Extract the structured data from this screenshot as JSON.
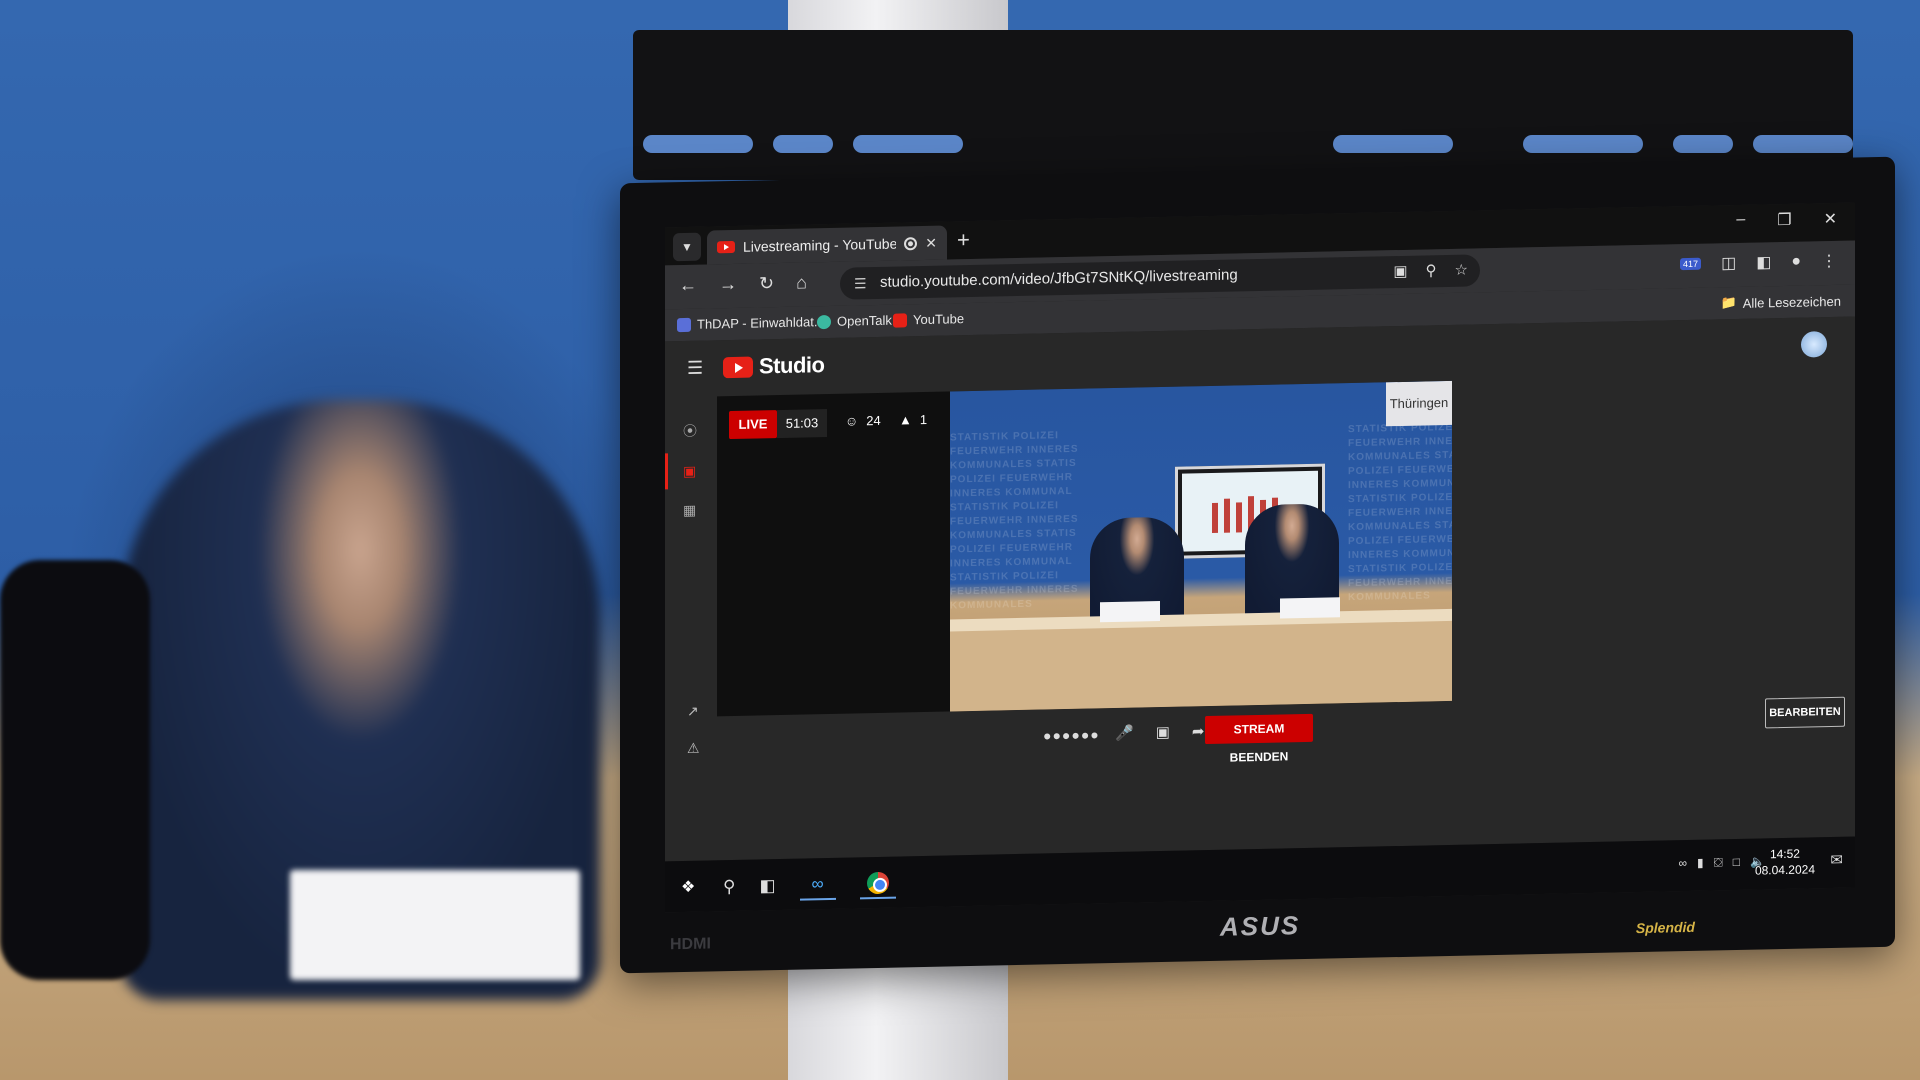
{
  "browser": {
    "tab_title": "Livestreaming - YouTube St",
    "url": "studio.youtube.com/video/JfbGt7SNtKQ/livestreaming",
    "extension_badge": "417",
    "bookmarks": [
      {
        "label": "ThDAP - Einwahldat...",
        "icon": "calendar-icon"
      },
      {
        "label": "OpenTalk",
        "icon": "opentalk-icon"
      },
      {
        "label": "YouTube",
        "icon": "youtube-icon"
      }
    ],
    "all_bookmarks": "Alle Lesezeichen"
  },
  "studio": {
    "logo_text": "Studio",
    "live_label": "LIVE",
    "elapsed": "51:03",
    "viewers": "24",
    "likes": "1",
    "video_logo_text": "Thüringen",
    "end_stream_label": "STREAM BEENDEN",
    "edit_label": "BEARBEITEN"
  },
  "monitor": {
    "brand": "ASUS",
    "port_label": "HDMI",
    "splendid_label": "Splendid"
  },
  "taskbar": {
    "time": "14:52",
    "date": "08.04.2024"
  },
  "colors": {
    "accent_red": "#cc0000",
    "background_blue": "#2f5c9e"
  }
}
